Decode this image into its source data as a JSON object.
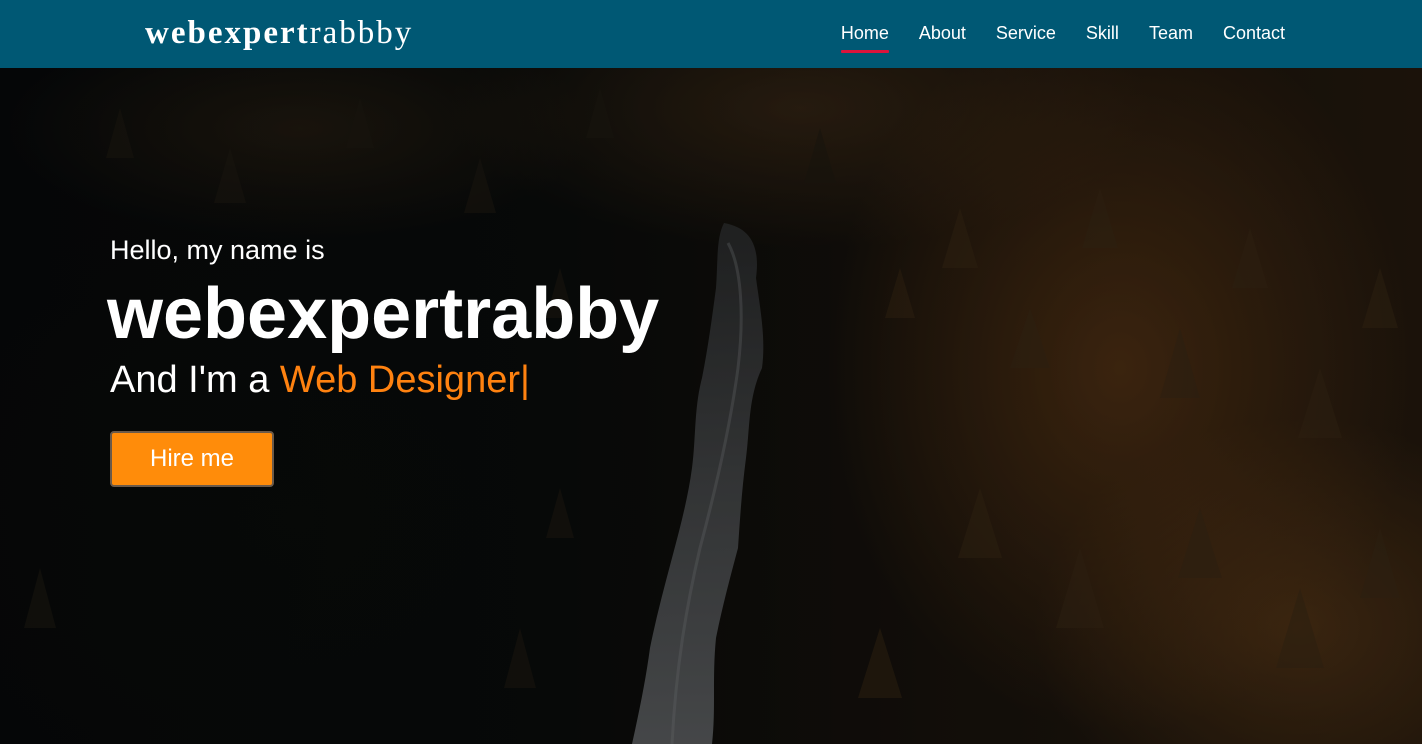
{
  "navbar": {
    "logo": {
      "bold_part": "webexpert",
      "light_part": "rabbby"
    },
    "menu": [
      {
        "label": "Home",
        "active": true
      },
      {
        "label": "About",
        "active": false
      },
      {
        "label": "Service",
        "active": false
      },
      {
        "label": "Skill",
        "active": false
      },
      {
        "label": "Team",
        "active": false
      },
      {
        "label": "Contact",
        "active": false
      }
    ],
    "colors": {
      "background": "#005874",
      "active_underline": "#dc143c"
    }
  },
  "hero": {
    "greeting": "Hello, my name is",
    "name": "webexpertrabby",
    "role_prefix": "And I'm a",
    "role": "Web Designer",
    "cursor": "|",
    "button_label": "Hire me",
    "colors": {
      "accent": "#ff8210",
      "button": "#ff8c0a",
      "text": "#ffffff"
    }
  }
}
